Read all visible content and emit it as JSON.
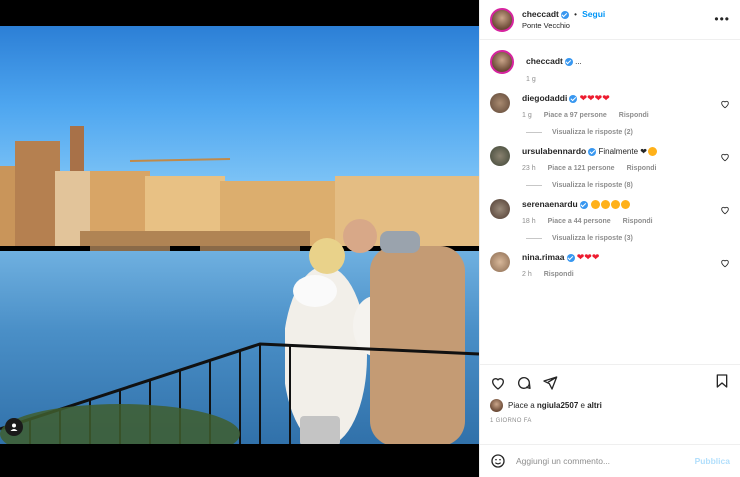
{
  "post": {
    "username": "checcadt",
    "follow_label": "Segui",
    "dot": "•",
    "location": "Ponte Vecchio",
    "caption_text": "...",
    "caption_age": "1 g"
  },
  "comments": [
    {
      "username": "diegodaddi",
      "text": "❤❤❤❤",
      "age": "1 g",
      "likes": "Piace a 97 persone",
      "reply": "Rispondi",
      "view_replies": "Visualizza le risposte (2)"
    },
    {
      "username": "ursulabennardo",
      "text": "Finalmente ❤",
      "age": "23 h",
      "likes": "Piace a 121 persone",
      "reply": "Rispondi",
      "view_replies": "Visualizza le risposte (8)"
    },
    {
      "username": "serenaenardu",
      "text": "",
      "age": "18 h",
      "likes": "Piace a 44 persone",
      "reply": "Rispondi",
      "view_replies": "Visualizza le risposte (3)"
    },
    {
      "username": "nina.rimaa",
      "text": "❤❤❤",
      "age": "2 h",
      "reply": "Rispondi"
    }
  ],
  "likes_row": {
    "prefix": "Piace a",
    "user": "ngiula2507",
    "conj": "e",
    "others": "altri"
  },
  "date": "1 giorno fa",
  "add_comment": {
    "placeholder": "Aggiungi un commento...",
    "publish": "Pubblica"
  },
  "icons": [
    "more-icon",
    "heart-icon",
    "comment-icon",
    "share-icon",
    "bookmark-icon",
    "emoji-icon",
    "user-tag-icon"
  ],
  "colors": {
    "accent": "#0095f6",
    "heart": "#ed1b2f",
    "verified": "#3897f0"
  }
}
